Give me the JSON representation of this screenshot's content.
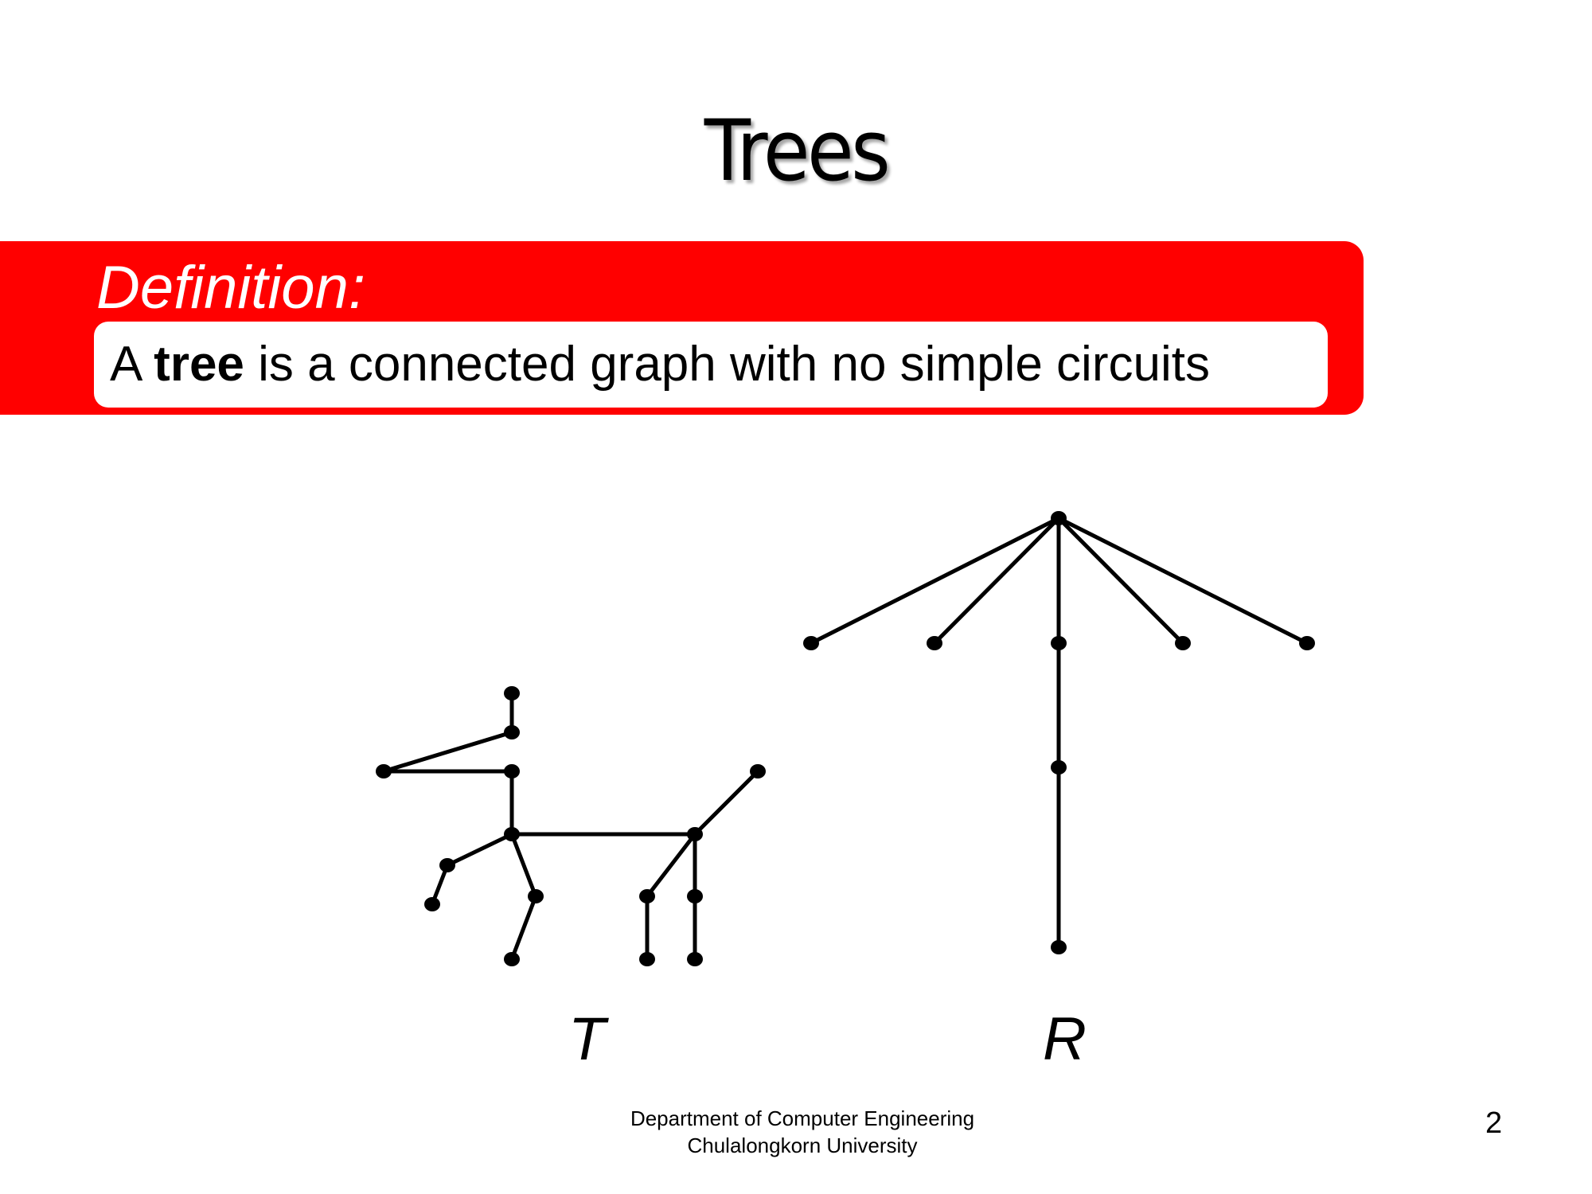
{
  "slide": {
    "title": "Trees",
    "definition_label": "Definition:",
    "definition": {
      "prefix": "A ",
      "term": "tree",
      "suffix": " is a connected graph with no simple circuits"
    },
    "graph_labels": {
      "t": "T",
      "r": "R"
    },
    "footer": {
      "line1": "Department of Computer Engineering",
      "line2": "Chulalongkorn University"
    },
    "page_number": "2"
  },
  "colors": {
    "accent": "#ff0000",
    "text": "#000000",
    "box": "#ffffff"
  }
}
